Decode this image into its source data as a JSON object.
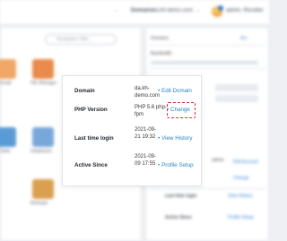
{
  "header": {
    "domains_label": "Domains",
    "domain_select_value": "da.kh-demo.com",
    "user_label": "admin, Reseller",
    "colors": {
      "bar": "#ffffff",
      "accent": "#2d7dd2"
    }
  },
  "background": {
    "search_placeholder": "Navigation Filter",
    "stats": [
      "Domains",
      "Bandwidth"
    ]
  },
  "popover": {
    "rows": [
      {
        "label": "Domain",
        "value": "da.kh-demo.com",
        "action": "Edit Domain"
      },
      {
        "label": "PHP Version",
        "value": "PHP 5.6 php-fpm",
        "action": "Change"
      },
      {
        "label": "Last time login",
        "value": "2021-09-21 19:32",
        "action": "View History"
      },
      {
        "label": "Active Since",
        "value": "2021-09-09 17:55",
        "action": "Profile Setup"
      }
    ],
    "action_color": "#2a86c8",
    "highlight_color": "#d32f2f"
  }
}
